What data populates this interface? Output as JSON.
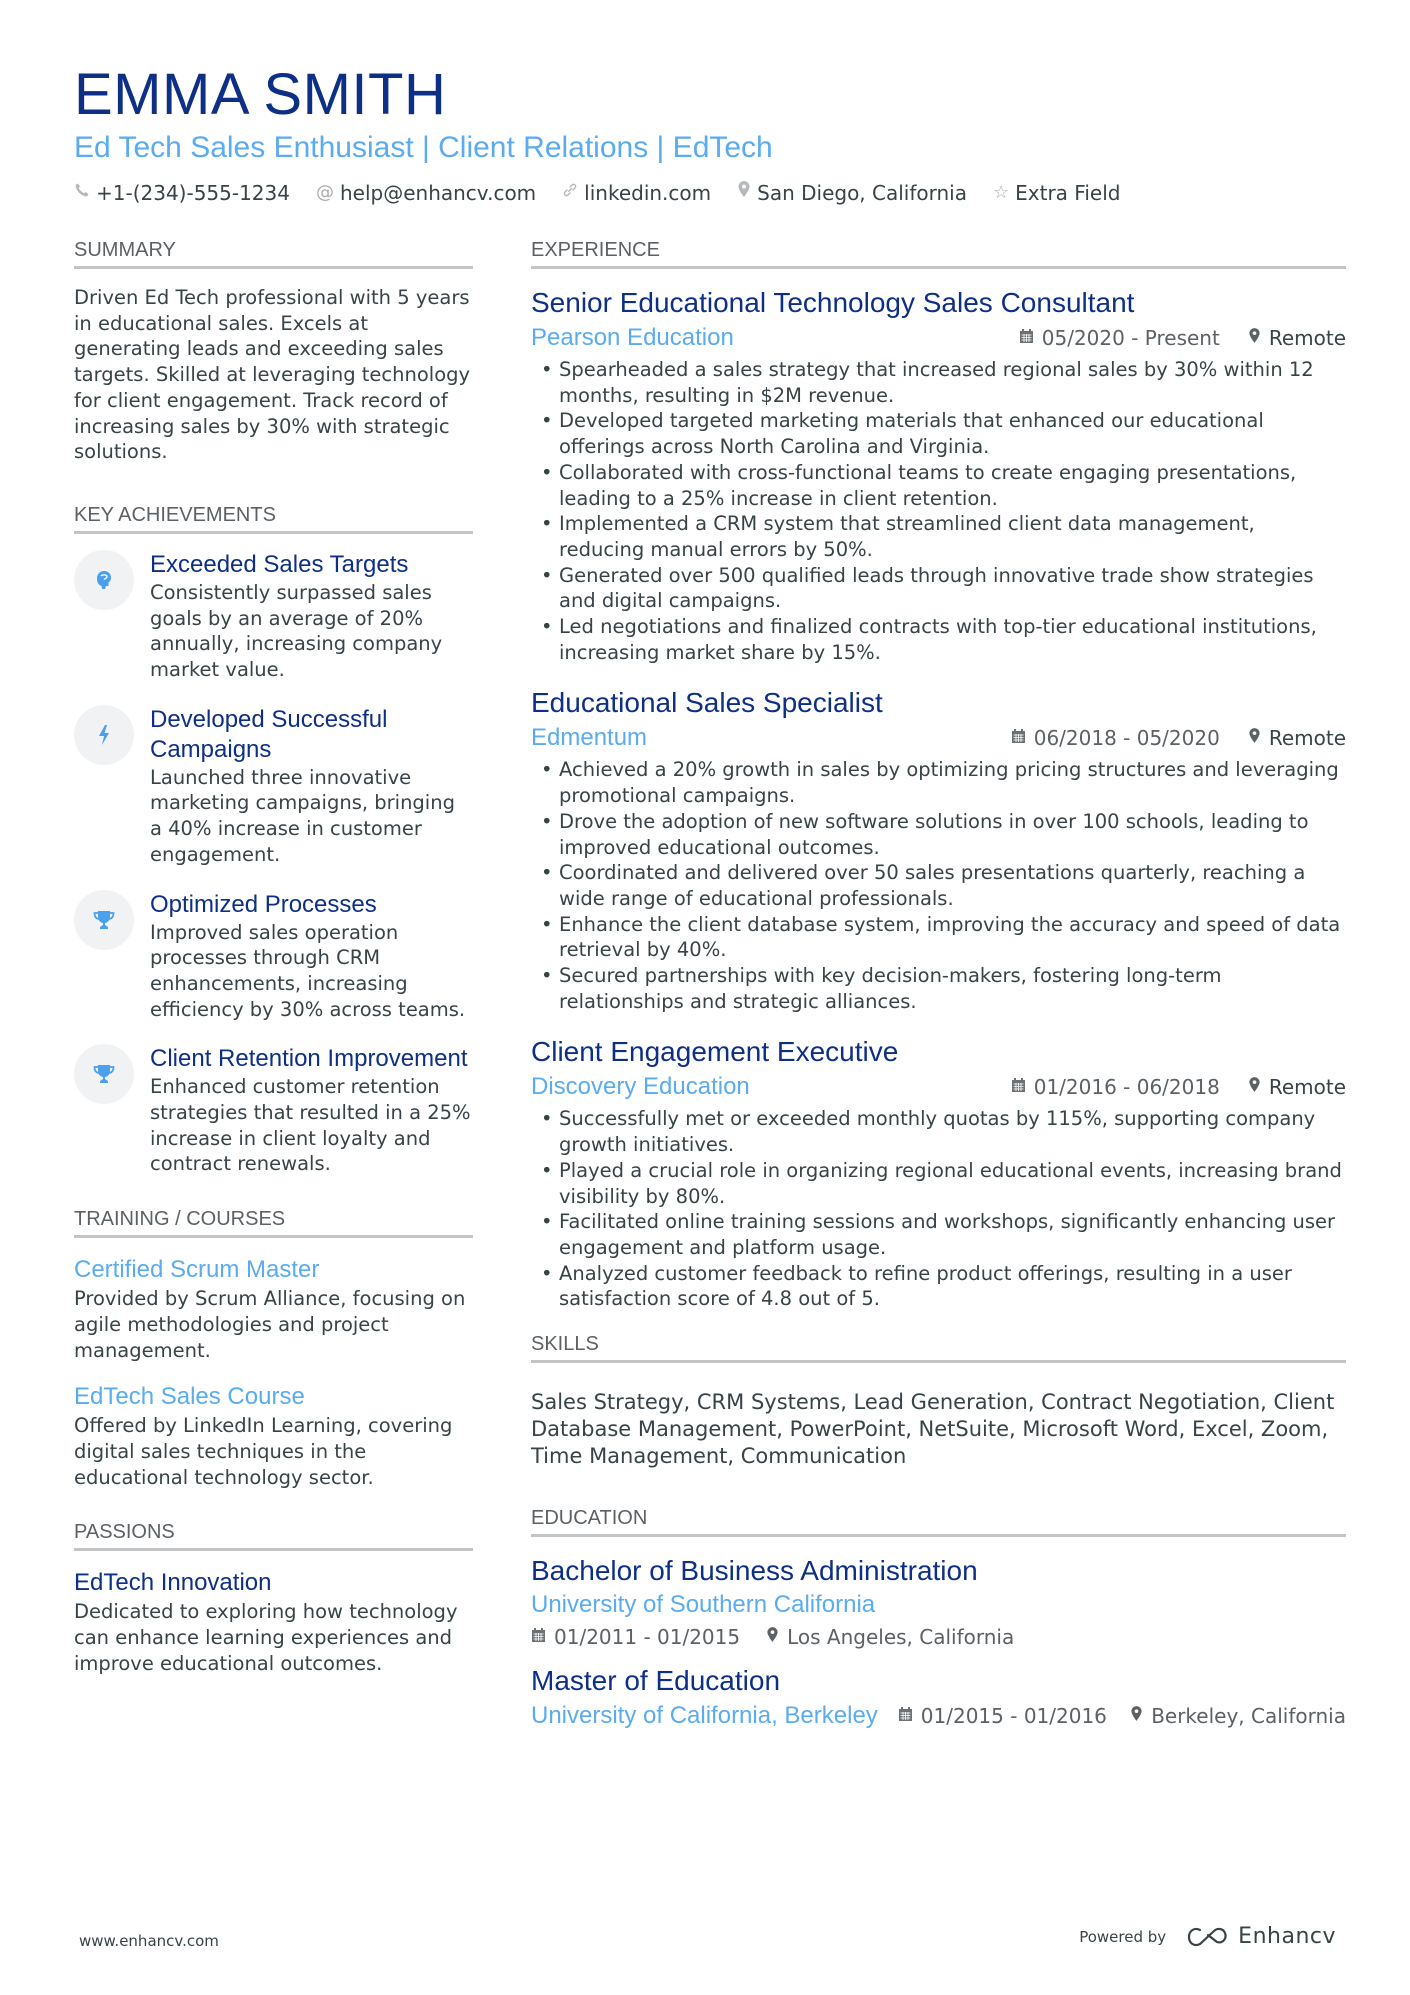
{
  "header": {
    "name": "EMMA SMITH",
    "title": "Ed Tech Sales Enthusiast | Client Relations | EdTech",
    "contacts": [
      {
        "icon": "phone-icon",
        "glyph": "✆",
        "text": "+1-(234)-555-1234"
      },
      {
        "icon": "at-icon",
        "glyph": "@",
        "text": "help@enhancv.com"
      },
      {
        "icon": "link-icon",
        "glyph": "🔗",
        "text": "linkedin.com"
      },
      {
        "icon": "location-pin-icon",
        "glyph": "⚲",
        "text": "San Diego, California"
      },
      {
        "icon": "star-icon",
        "glyph": "☆",
        "text": "Extra Field"
      }
    ]
  },
  "colors": {
    "name": "#0e2f86",
    "accent": "#5aabf0",
    "text": "#384347",
    "muted": "#5b6165",
    "rule": "#c2c4c6"
  },
  "summary": {
    "heading": "SUMMARY",
    "text": "Driven Ed Tech professional with 5 years in educational sales. Excels at generating leads and exceeding sales targets. Skilled at leveraging technology for client engagement. Track record of increasing sales by 30% with strategic solutions."
  },
  "achievements": {
    "heading": "KEY ACHIEVEMENTS",
    "items": [
      {
        "icon": "head-icon",
        "title": "Exceeded Sales Targets",
        "text": "Consistently surpassed sales goals by an average of 20% annually, increasing company market value."
      },
      {
        "icon": "lightning-icon",
        "title": "Developed Successful Campaigns",
        "text": "Launched three innovative marketing campaigns, bringing a 40% increase in customer engagement."
      },
      {
        "icon": "trophy-icon",
        "title": "Optimized Processes",
        "text": "Improved sales operation processes through CRM enhancements, increasing efficiency by 30% across teams."
      },
      {
        "icon": "trophy-icon",
        "title": "Client Retention Improvement",
        "text": "Enhanced customer retention strategies that resulted in a 25% increase in client loyalty and contract renewals."
      }
    ]
  },
  "training": {
    "heading": "TRAINING / COURSES",
    "items": [
      {
        "title": "Certified Scrum Master",
        "text": "Provided by Scrum Alliance, focusing on agile methodologies and project management."
      },
      {
        "title": "EdTech Sales Course",
        "text": "Offered by LinkedIn Learning, covering digital sales techniques in the educational technology sector."
      }
    ]
  },
  "passions": {
    "heading": "PASSIONS",
    "items": [
      {
        "title": "EdTech Innovation",
        "text": "Dedicated to exploring how technology can enhance learning experiences and improve educational outcomes."
      }
    ]
  },
  "experience": {
    "heading": "EXPERIENCE",
    "jobs": [
      {
        "title": "Senior Educational Technology Sales Consultant",
        "company": "Pearson Education",
        "dates": "05/2020 - Present",
        "location": "Remote",
        "bullets": [
          "Spearheaded a sales strategy that increased regional sales by 30% within 12 months, resulting in $2M revenue.",
          "Developed targeted marketing materials that enhanced our educational offerings across North Carolina and Virginia.",
          "Collaborated with cross-functional teams to create engaging presentations, leading to a 25% increase in client retention.",
          "Implemented a CRM system that streamlined client data management, reducing manual errors by 50%.",
          "Generated over 500 qualified leads through innovative trade show strategies and digital campaigns.",
          "Led negotiations and finalized contracts with top-tier educational institutions, increasing market share by 15%."
        ]
      },
      {
        "title": "Educational Sales Specialist",
        "company": "Edmentum",
        "dates": "06/2018 - 05/2020",
        "location": "Remote",
        "bullets": [
          "Achieved a 20% growth in sales by optimizing pricing structures and leveraging promotional campaigns.",
          "Drove the adoption of new software solutions in over 100 schools, leading to improved educational outcomes.",
          "Coordinated and delivered over 50 sales presentations quarterly, reaching a wide range of educational professionals.",
          "Enhance the client database system, improving the accuracy and speed of data retrieval by 40%.",
          "Secured partnerships with key decision-makers, fostering long-term relationships and strategic alliances."
        ]
      },
      {
        "title": "Client Engagement Executive",
        "company": "Discovery Education",
        "dates": "01/2016 - 06/2018",
        "location": "Remote",
        "bullets": [
          "Successfully met or exceeded monthly quotas by 115%, supporting company growth initiatives.",
          "Played a crucial role in organizing regional educational events, increasing brand visibility by 80%.",
          "Facilitated online training sessions and workshops, significantly enhancing user engagement and platform usage.",
          "Analyzed customer feedback to refine product offerings, resulting in a user satisfaction score of 4.8 out of 5."
        ]
      }
    ]
  },
  "skills": {
    "heading": "SKILLS",
    "text": "Sales Strategy, CRM Systems, Lead Generation, Contract Negotiation, Client Database Management, PowerPoint, NetSuite, Microsoft Word, Excel, Zoom, Time Management, Communication"
  },
  "education": {
    "heading": "EDUCATION",
    "items": [
      {
        "degree": "Bachelor of Business Administration",
        "school": "University of Southern California",
        "dates": "01/2011 - 01/2015",
        "location": "Los Angeles, California"
      },
      {
        "degree": "Master of Education",
        "school": "University of California, Berkeley",
        "dates": "01/2015 - 01/2016",
        "location": "Berkeley, California"
      }
    ]
  },
  "footer": {
    "website": "www.enhancv.com",
    "powered_by": "Powered by",
    "brand": "Enhancv"
  }
}
